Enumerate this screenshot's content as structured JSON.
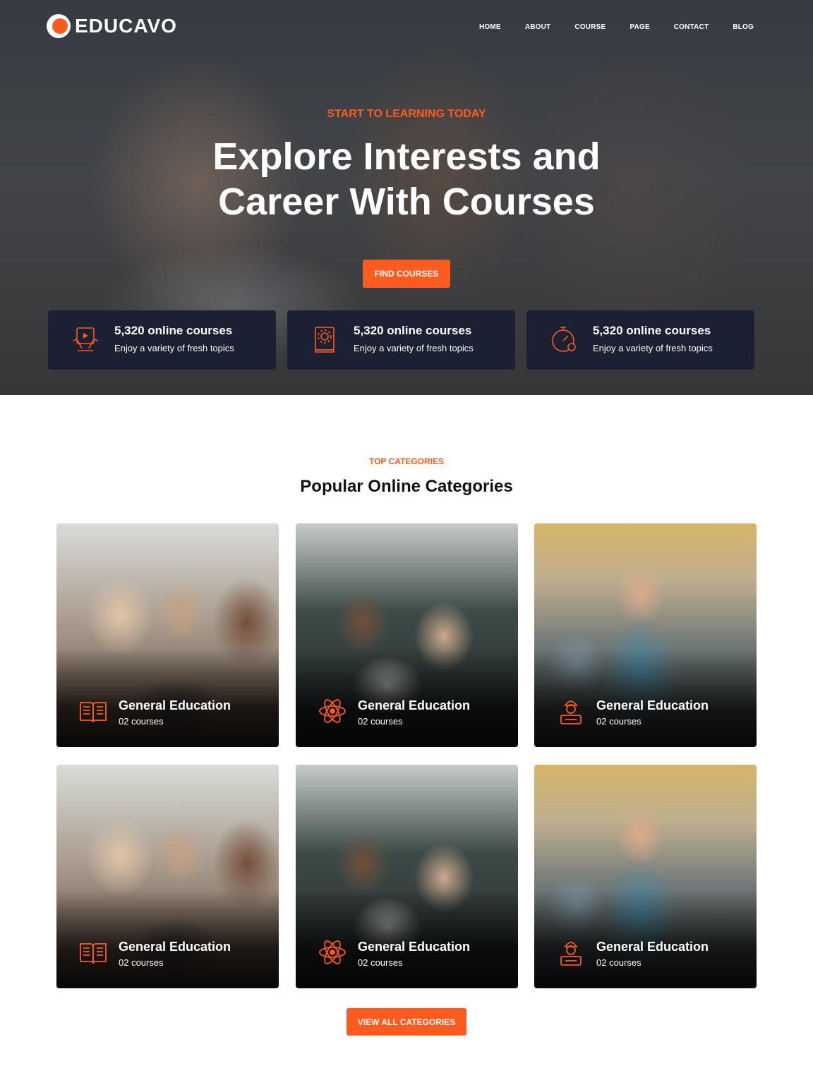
{
  "brand": {
    "name": "EDUCAVO",
    "accent": "#ff5a1f",
    "dark": "#1b2032"
  },
  "nav": [
    {
      "label": "HOME"
    },
    {
      "label": "ABOUT"
    },
    {
      "label": "COURSE"
    },
    {
      "label": "PAGE"
    },
    {
      "label": "CONTACT"
    },
    {
      "label": "BLOG"
    }
  ],
  "hero": {
    "eyebrow": "START TO LEARNING TODAY",
    "title_line1": "Explore Interests and",
    "title_line2": "Career With Courses",
    "button": "FIND COURSES"
  },
  "stats": [
    {
      "icon": "video-tablet-icon",
      "title": "5,320 online courses",
      "subtitle": "Enjoy a variety of fresh topics"
    },
    {
      "icon": "gear-book-icon",
      "title": "5,320 online courses",
      "subtitle": "Enjoy a variety of fresh topics"
    },
    {
      "icon": "stopwatch-icon",
      "title": "5,320 online courses",
      "subtitle": "Enjoy a variety of fresh topics"
    }
  ],
  "categories": {
    "eyebrow": "TOP CATEGORIES",
    "title": "Popular Online Categories",
    "items": [
      {
        "icon": "book-icon",
        "title": "General Education",
        "count": "02 courses"
      },
      {
        "icon": "atom-icon",
        "title": "General Education",
        "count": "02 courses"
      },
      {
        "icon": "engineer-icon",
        "title": "General Education",
        "count": "02 courses"
      },
      {
        "icon": "book-icon",
        "title": "General Education",
        "count": "02 courses"
      },
      {
        "icon": "atom-icon",
        "title": "General Education",
        "count": "02 courses"
      },
      {
        "icon": "engineer-icon",
        "title": "General Education",
        "count": "02 courses"
      }
    ],
    "button": "VIEW ALL CATEGORIES"
  }
}
